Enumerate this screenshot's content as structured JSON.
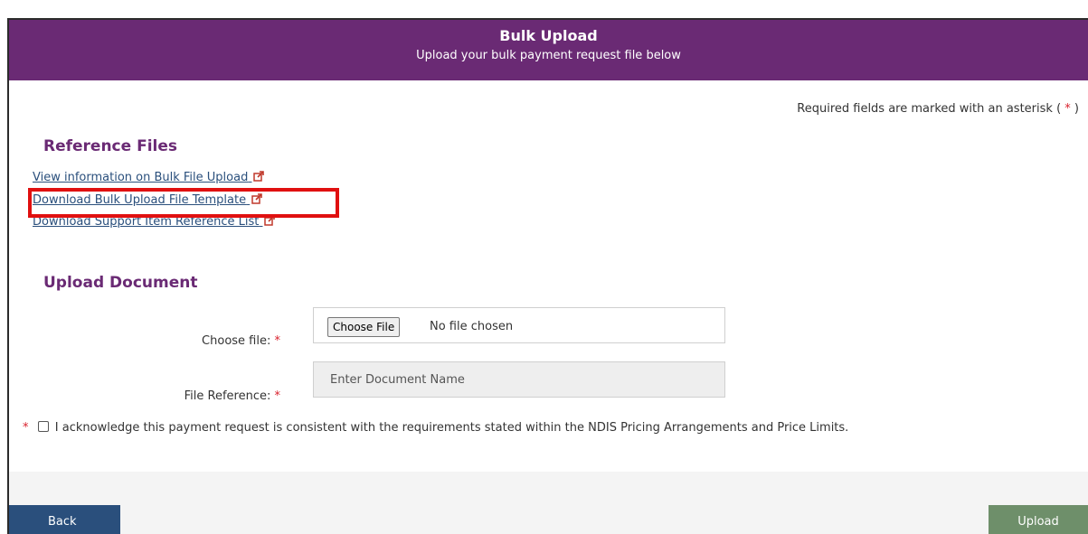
{
  "header": {
    "title": "Bulk Upload",
    "subtitle": "Upload your bulk payment request file below"
  },
  "required_note": {
    "prefix": "Required fields are marked with an asterisk (",
    "asterisk": "*",
    "suffix": ")"
  },
  "reference_files": {
    "heading": "Reference Files",
    "links": [
      {
        "label": "View information on Bulk File Upload"
      },
      {
        "label": "Download Bulk Upload File Template"
      },
      {
        "label": "Download Support Item Reference List"
      }
    ]
  },
  "upload_document": {
    "heading": "Upload Document",
    "choose_file_label": "Choose file:",
    "choose_file_button": "Choose File",
    "no_file_text": "No file chosen",
    "file_reference_label": "File Reference:",
    "file_reference_placeholder": "Enter Document Name",
    "asterisk": "*"
  },
  "acknowledgement": {
    "text": "I acknowledge this payment request is consistent with the requirements stated within the NDIS Pricing Arrangements and Price Limits.",
    "checked": false
  },
  "footer": {
    "back_label": "Back",
    "upload_label": "Upload"
  },
  "colors": {
    "header_bg": "#6a2a74",
    "link": "#2a4f7c",
    "required": "#d9212c",
    "highlight": "#e01010",
    "back_button": "#2a4f7c",
    "upload_button": "#6e8f6a"
  },
  "icons": {
    "external_link": "external-link-icon"
  }
}
